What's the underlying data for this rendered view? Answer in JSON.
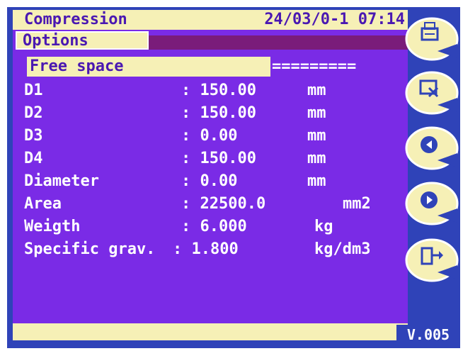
{
  "header": {
    "title": "Compression",
    "datetime": "24/03/0-1 07:14"
  },
  "menu": {
    "options_label": "Options",
    "free_space_label": "Free space",
    "free_space_bar": "========="
  },
  "rows": [
    {
      "label": "D1",
      "value": ": 150.00",
      "unit": "mm"
    },
    {
      "label": "D2",
      "value": ": 150.00",
      "unit": "mm"
    },
    {
      "label": "D3",
      "value": ": 0.00",
      "unit": "mm"
    },
    {
      "label": "D4",
      "value": ": 150.00",
      "unit": "mm"
    },
    {
      "label": "Diameter",
      "value": ": 0.00",
      "unit": "mm"
    },
    {
      "label": "Area",
      "value": ": 22500.0",
      "unit": "mm2"
    },
    {
      "label": "Weigth",
      "value": ": 6.000",
      "unit": "kg"
    },
    {
      "label": "Specific grav.",
      "value": ": 1.800",
      "unit": "kg/dm3"
    }
  ],
  "footer": {
    "version": "V.005"
  },
  "side_buttons": [
    {
      "icon": "print-icon"
    },
    {
      "icon": "delete-icon"
    },
    {
      "icon": "previous-icon"
    },
    {
      "icon": "next-icon"
    },
    {
      "icon": "exit-icon"
    }
  ],
  "colors": {
    "screen_bg": "#7a2be6",
    "bezel": "#2f43b8",
    "highlight": "#f6f0b6",
    "text_on_highlight": "#4a18b2"
  }
}
